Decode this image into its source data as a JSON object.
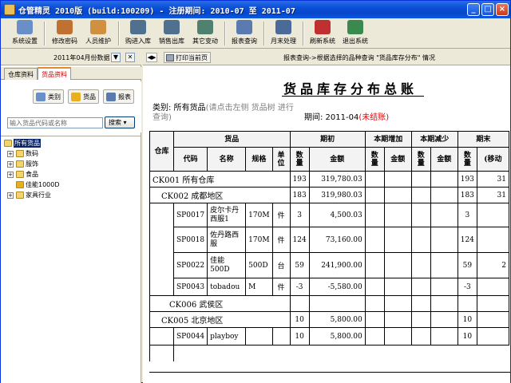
{
  "window": {
    "title": "仓管精灵 2010版 (build:100209) - 注册期间: 2010-07 至 2011-07",
    "minimize": "_",
    "maximize": "□",
    "close": "×"
  },
  "toolbar": {
    "items": [
      {
        "label": "系统设置",
        "icon": "settings-icon",
        "color": "#6a8fc8"
      },
      {
        "label": "修改密码",
        "icon": "password-icon",
        "color": "#c07030"
      },
      {
        "label": "人员维护",
        "icon": "users-icon",
        "color": "#d09040"
      },
      {
        "label": "购进入库",
        "icon": "stock-in-icon",
        "color": "#507090"
      },
      {
        "label": "销售出库",
        "icon": "stock-out-icon",
        "color": "#507090"
      },
      {
        "label": "其它变动",
        "icon": "other-change-icon",
        "color": "#508070"
      },
      {
        "label": "报表查询",
        "icon": "report-icon",
        "color": "#5a7ab0"
      },
      {
        "label": "月末处理",
        "icon": "month-end-icon",
        "color": "#4a6a9a"
      },
      {
        "label": "刷新系统",
        "icon": "refresh-icon",
        "color": "#c03030"
      },
      {
        "label": "退出系统",
        "icon": "exit-icon",
        "color": "#3a8a50"
      }
    ]
  },
  "left_panel": {
    "period_label": "2011年04月份数据",
    "dropdown_btn": "▼",
    "close_btn": "✕",
    "tabs": [
      {
        "label": "仓库资料",
        "active": false
      },
      {
        "label": "货品资料",
        "active": true
      }
    ],
    "buttons": {
      "category": "类别",
      "goods": "货品",
      "report": "报表"
    },
    "search": {
      "value": "",
      "placeholder": "输入货品代码或名称",
      "button": "搜索"
    },
    "tree": {
      "root": "所有货品",
      "children": [
        {
          "label": "数码",
          "expander": "+"
        },
        {
          "label": "服饰",
          "expander": "+"
        },
        {
          "label": "食品",
          "expander": "+"
        },
        {
          "label": "佳能1000D",
          "expander": ""
        },
        {
          "label": "家具行业",
          "expander": "+"
        }
      ]
    }
  },
  "right_panel": {
    "nav": "◀▶",
    "print_button": "打印当前页",
    "breadcrumb": "报表查询->根据选择的品种查询 \"货品库存分布\" 情况",
    "report": {
      "title": "货品库存分布总账",
      "category_label": "类别: 所有货品",
      "category_hint": "(请点击左侧 货品树 进行查询)",
      "period_label": "期间:  2011-04",
      "period_status": "(未结账)",
      "headers": {
        "warehouse": "仓库",
        "goods": "货品",
        "code": "代码",
        "name": "名称",
        "spec": "规格",
        "unit": "单位",
        "opening": "期初",
        "increase": "本期增加",
        "decrease": "本期减少",
        "closing": "期末",
        "qty": "数量",
        "amount": "金额",
        "moving_avg": "(移动"
      },
      "rows": [
        {
          "type": "group",
          "label": "CK001 所有仓库",
          "qty": "193",
          "amount": "319,780.03",
          "end_qty": "193",
          "end_amt": "31"
        },
        {
          "type": "group",
          "label": "CK002 成都地区",
          "qty": "183",
          "amount": "319,980.03",
          "end_qty": "183",
          "end_amt": "31"
        },
        {
          "type": "item",
          "code": "SP0017",
          "name": "皮尔卡丹西服1",
          "spec": "170M",
          "unit": "件",
          "qty": "3",
          "amount": "4,500.03",
          "end_qty": "3",
          "end_amt": ""
        },
        {
          "type": "item",
          "code": "SP0018",
          "name": "佐丹路西服",
          "spec": "170M",
          "unit": "件",
          "qty": "124",
          "amount": "73,160.00",
          "end_qty": "124",
          "end_amt": ""
        },
        {
          "type": "item",
          "code": "SP0022",
          "name": "佳能500D",
          "spec": "500D",
          "unit": "台",
          "qty": "59",
          "amount": "241,900.00",
          "end_qty": "59",
          "end_amt": "2"
        },
        {
          "type": "item",
          "code": "SP0043",
          "name": "tobadou",
          "spec": "M",
          "unit": "件",
          "qty": "-3",
          "amount": "-5,580.00",
          "end_qty": "-3",
          "end_amt": ""
        },
        {
          "type": "group",
          "label": "CK006 武侯区",
          "qty": "",
          "amount": "",
          "end_qty": "",
          "end_amt": ""
        },
        {
          "type": "group",
          "label": "CK005 北京地区",
          "qty": "10",
          "amount": "5,800.00",
          "end_qty": "10",
          "end_amt": ""
        },
        {
          "type": "item",
          "code": "SP0044",
          "name": "playboy",
          "spec": "",
          "unit": "",
          "qty": "10",
          "amount": "5,800.00",
          "end_qty": "10",
          "end_amt": ""
        }
      ]
    }
  }
}
